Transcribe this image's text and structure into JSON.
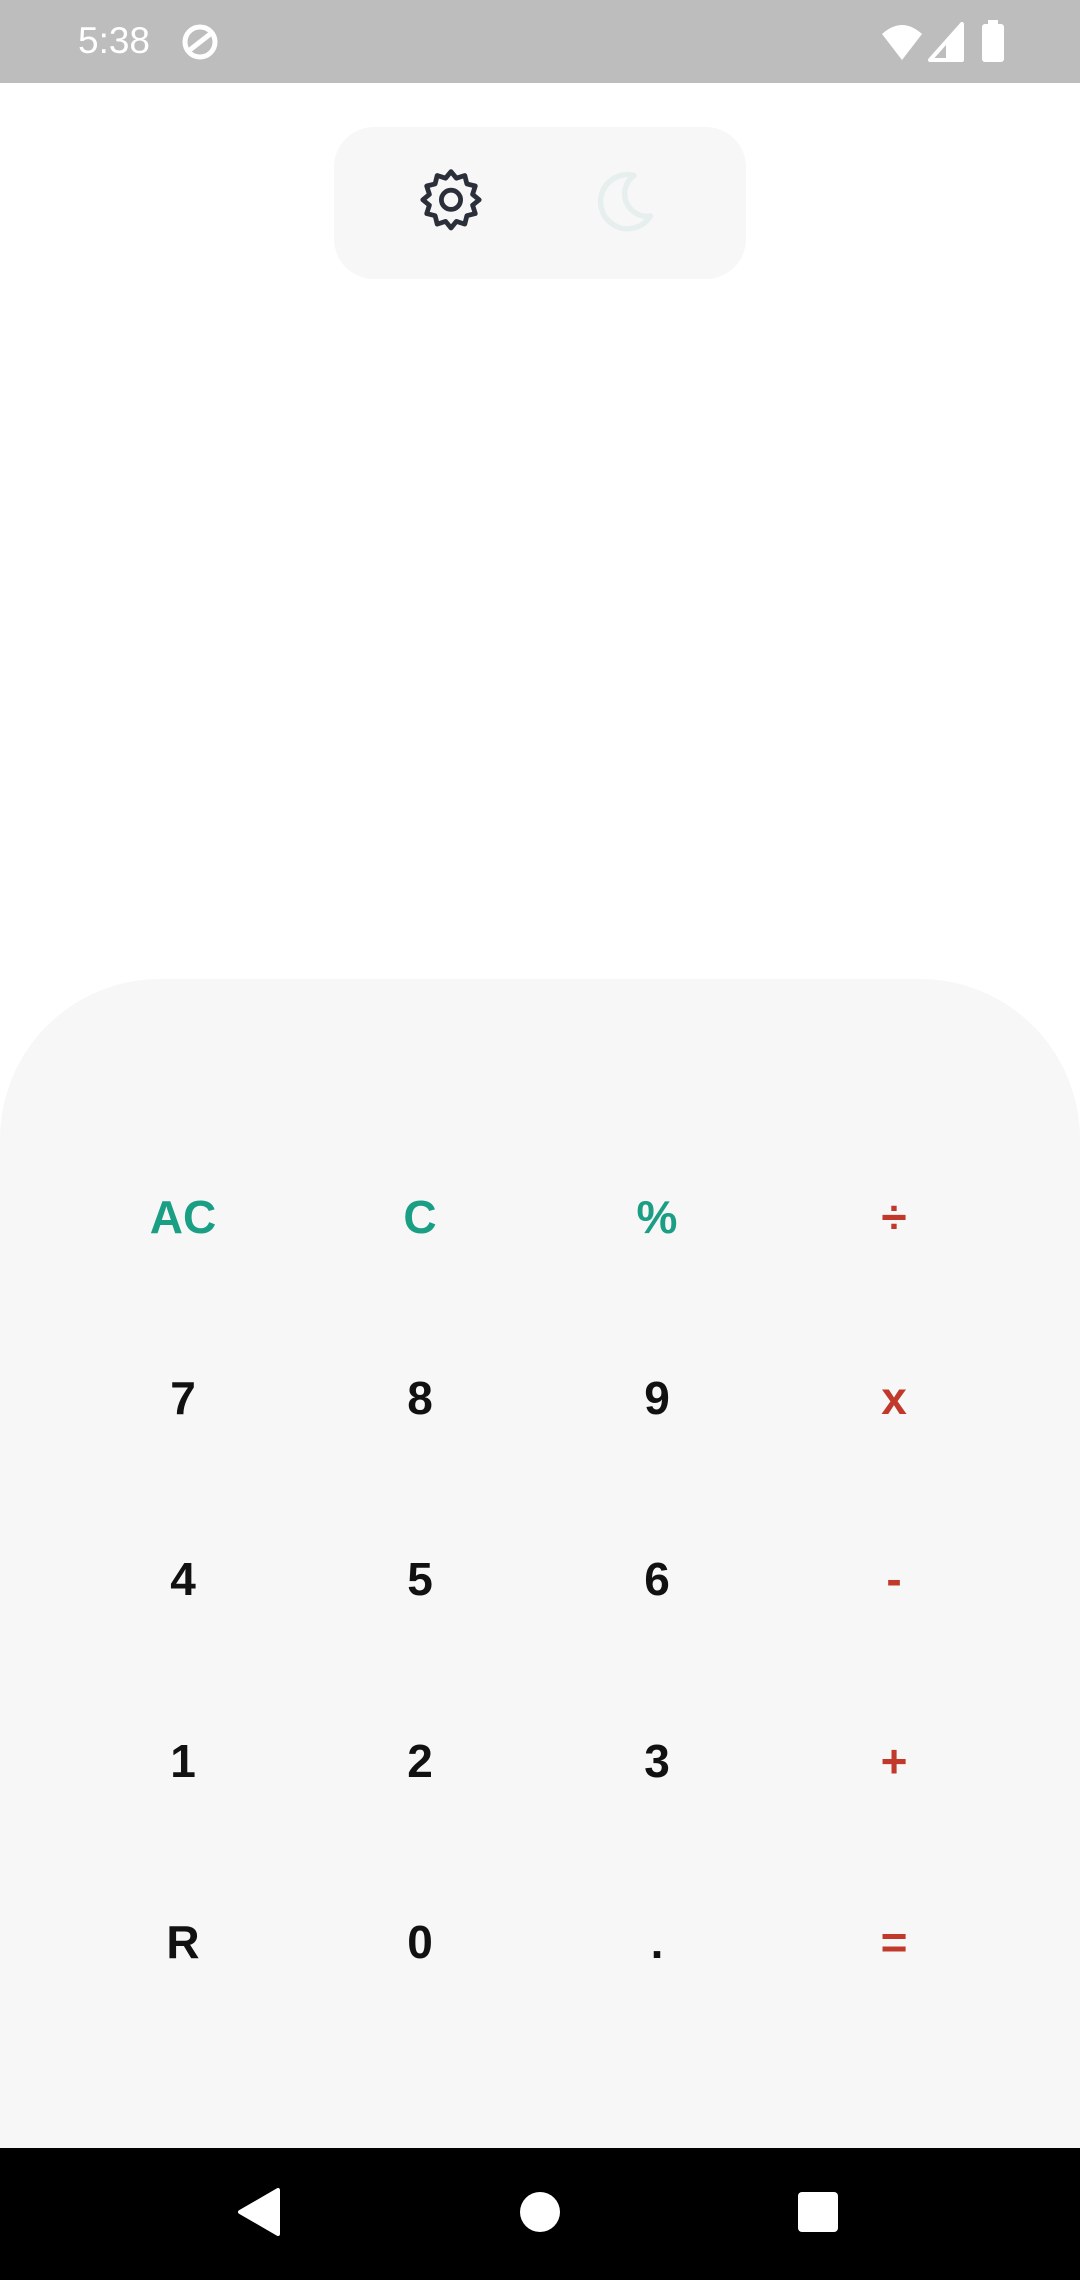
{
  "status_bar": {
    "time": "5:38",
    "icons": [
      "sync-icon",
      "wifi-icon",
      "cell-signal-icon",
      "battery-icon"
    ]
  },
  "toolbar": {
    "settings_icon": "gear-icon",
    "theme_icon": "moon-icon"
  },
  "display": {
    "expression": "",
    "result": ""
  },
  "keypad": {
    "rows": [
      [
        {
          "label": "AC",
          "kind": "func"
        },
        {
          "label": "C",
          "kind": "func"
        },
        {
          "label": "%",
          "kind": "func"
        },
        {
          "label": "÷",
          "kind": "op"
        }
      ],
      [
        {
          "label": "7",
          "kind": "num"
        },
        {
          "label": "8",
          "kind": "num"
        },
        {
          "label": "9",
          "kind": "num"
        },
        {
          "label": "x",
          "kind": "op"
        }
      ],
      [
        {
          "label": "4",
          "kind": "num"
        },
        {
          "label": "5",
          "kind": "num"
        },
        {
          "label": "6",
          "kind": "num"
        },
        {
          "label": "-",
          "kind": "op"
        }
      ],
      [
        {
          "label": "1",
          "kind": "num"
        },
        {
          "label": "2",
          "kind": "num"
        },
        {
          "label": "3",
          "kind": "num"
        },
        {
          "label": "+",
          "kind": "op"
        }
      ],
      [
        {
          "label": "R",
          "kind": "num"
        },
        {
          "label": "0",
          "kind": "num"
        },
        {
          "label": ".",
          "kind": "num"
        },
        {
          "label": "=",
          "kind": "op"
        }
      ]
    ]
  },
  "nav_bar": {
    "icons": [
      "back-icon",
      "home-icon",
      "recents-icon"
    ]
  },
  "colors": {
    "func": "#1a9e84",
    "op": "#c0392b",
    "num": "#111111",
    "keypad_bg": "#f7f7f7",
    "status_bg": "#bdbdbd"
  }
}
